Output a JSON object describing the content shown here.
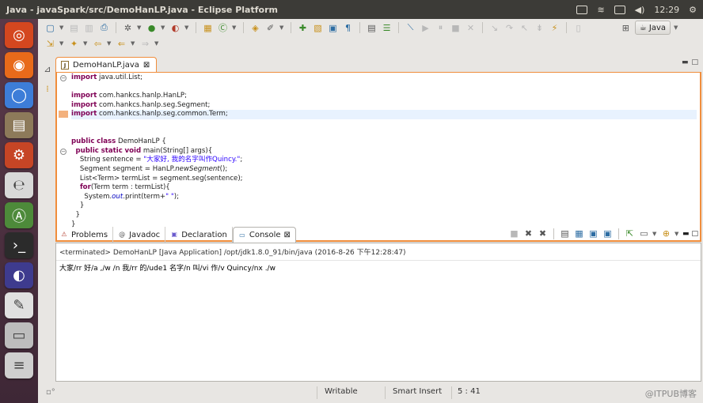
{
  "window": {
    "title": "Java - javaSpark/src/DemoHanLP.java - Eclipse Platform",
    "clock": "12:29"
  },
  "colors": {
    "accent": "#f08d3c",
    "keyword": "#7f0055",
    "string": "#2a00ff",
    "field": "#0000c0"
  },
  "launcher": {
    "items": [
      {
        "icon": "ubuntu-dash-icon",
        "glyph": "◎",
        "color": "#d4471f"
      },
      {
        "icon": "firefox-icon",
        "glyph": "◉",
        "color": "#e86a1a"
      },
      {
        "icon": "chromium-icon",
        "glyph": "◯",
        "color": "#3d7dd8"
      },
      {
        "icon": "files-icon",
        "glyph": "▤",
        "color": "#8d7a5a"
      },
      {
        "icon": "settings-icon",
        "glyph": "⚙",
        "color": "#c64525"
      },
      {
        "icon": "libreoffice-icon",
        "glyph": "℮",
        "color": "#d8d8d8"
      },
      {
        "icon": "software-center-icon",
        "glyph": "Ⓐ",
        "color": "#4d8a3a"
      },
      {
        "icon": "terminal-icon",
        "glyph": "›_",
        "color": "#2b2b2b"
      },
      {
        "icon": "eclipse-icon",
        "glyph": "◐",
        "color": "#3e3b8e"
      },
      {
        "icon": "text-editor-icon",
        "glyph": "✎",
        "color": "#e0e0e0"
      },
      {
        "icon": "drive-icon",
        "glyph": "▭",
        "color": "#bdbdbd"
      },
      {
        "icon": "workspace-switcher-icon",
        "glyph": "≡",
        "color": "#cfcfcf"
      }
    ]
  },
  "perspective": {
    "label": "Java"
  },
  "editor": {
    "tab_label": "DemoHanLP.java",
    "lines": [
      {
        "segs": [
          {
            "t": "import",
            "c": "kw"
          },
          {
            "t": " java.util.List;"
          }
        ],
        "fold": "⊖"
      },
      {
        "segs": []
      },
      {
        "segs": [
          {
            "t": "import",
            "c": "kw"
          },
          {
            "t": " com.hankcs.hanlp.HanLP;"
          }
        ]
      },
      {
        "segs": [
          {
            "t": "import",
            "c": "kw"
          },
          {
            "t": " com.hankcs.hanlp.seg.Segment;"
          }
        ]
      },
      {
        "segs": [
          {
            "t": "import",
            "c": "kw"
          },
          {
            "t": " com.hankcs.hanlp.seg.common.Term;"
          }
        ],
        "highlight": true,
        "marker": true
      },
      {
        "segs": []
      },
      {
        "segs": []
      },
      {
        "segs": [
          {
            "t": "public",
            "c": "kw"
          },
          {
            "t": " "
          },
          {
            "t": "class",
            "c": "kw"
          },
          {
            "t": " DemoHanLP {"
          }
        ]
      },
      {
        "segs": [
          {
            "t": "  "
          },
          {
            "t": "public",
            "c": "kw"
          },
          {
            "t": " "
          },
          {
            "t": "static",
            "c": "kw"
          },
          {
            "t": " "
          },
          {
            "t": "void",
            "c": "kw"
          },
          {
            "t": " main(String[] args){"
          }
        ],
        "fold": "⊖"
      },
      {
        "segs": [
          {
            "t": "    String sentence = "
          },
          {
            "t": "\"大家好, 我的名字叫作Quincy.\"",
            "c": "str"
          },
          {
            "t": ";"
          }
        ]
      },
      {
        "segs": [
          {
            "t": "    Segment segment = HanLP."
          },
          {
            "t": "newSegment",
            "c": "it"
          },
          {
            "t": "();"
          }
        ]
      },
      {
        "segs": [
          {
            "t": "    List<Term> termList = segment.seg(sentence);"
          }
        ]
      },
      {
        "segs": [
          {
            "t": "    "
          },
          {
            "t": "for",
            "c": "kw"
          },
          {
            "t": "(Term term : termList){"
          }
        ]
      },
      {
        "segs": [
          {
            "t": "      System."
          },
          {
            "t": "out",
            "c": "fld"
          },
          {
            "t": ".print(term+"
          },
          {
            "t": "\" \"",
            "c": "str"
          },
          {
            "t": ");"
          }
        ]
      },
      {
        "segs": [
          {
            "t": "    }"
          }
        ]
      },
      {
        "segs": [
          {
            "t": "  }"
          }
        ]
      },
      {
        "segs": [
          {
            "t": "}"
          }
        ]
      }
    ]
  },
  "views": {
    "tabs": [
      {
        "label": "Problems",
        "icon": "problems-icon",
        "glyph": "⚠",
        "color": "#b23b2b"
      },
      {
        "label": "Javadoc",
        "icon": "javadoc-icon",
        "glyph": "@",
        "color": "#555"
      },
      {
        "label": "Declaration",
        "icon": "declaration-icon",
        "glyph": "▣",
        "color": "#6a5acd"
      },
      {
        "label": "Console",
        "icon": "console-icon",
        "glyph": "▭",
        "color": "#2d6da3",
        "active": true
      }
    ]
  },
  "console": {
    "status": "<terminated> DemoHanLP [Java Application] /opt/jdk1.8.0_91/bin/java (2016-8-26 下午12:28:47)",
    "output": "大家/rr 好/a ,/w /n 我/rr 的/ude1 名字/n 叫/vi 作/v Quincy/nx ./w"
  },
  "status_bar": {
    "writable": "Writable",
    "insert_mode": "Smart Insert",
    "position": "5 : 41"
  },
  "watermark": "@ITPUB博客"
}
